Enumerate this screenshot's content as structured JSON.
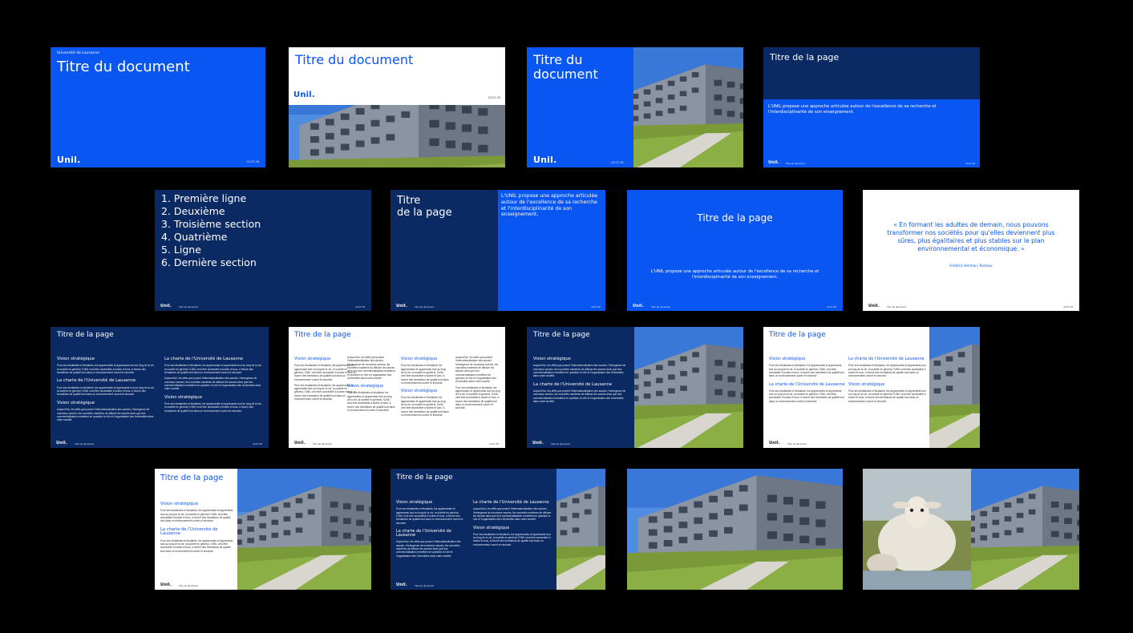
{
  "brand": {
    "logo": "Unil.",
    "university": "Université de Lausanne",
    "date": "23.07.25",
    "footer_title": "Titre du document"
  },
  "colors": {
    "blue": "#0a56f3",
    "navy": "#0b2a63",
    "white": "#ffffff",
    "background": "#000000"
  },
  "texts": {
    "doc_title": "Titre du document",
    "doc_title_line1": "Titre du",
    "doc_title_line2": "document",
    "page_title": "Titre de la page",
    "page_title_line1": "Titre",
    "page_title_line2": "de la page",
    "intro": "L'UNIL propose une approche articulée autour de l'excellence de sa recherche et l'interdisciplinarité de son enseignement.",
    "toc": [
      "1. Première ligne",
      "2. Deuxième",
      "3. Troisième section",
      "4. Quatrième",
      "5. Ligne",
      "6. Dernière section"
    ],
    "quote": "« En formant les adultes de demain, nous pouvons transformer nos sociétés pour qu'elles deviennent plus sûres, plus égalitaires et plus stables sur le plan environnemental et économique. »",
    "quote_author": "Frédéric Herman, Recteur",
    "heading_vision": "Vision stratégique",
    "heading_charte": "La charte de l'Université de Lausanne",
    "body_1": "Pour ses étudiantes et étudiants, les apprenantes et apprenants tout au long de la vie, la société en général, l'UNIL veut être accessible à toutes et tous, à fournir des formations de qualité tout dans un environnement ouvert et sécurisé.",
    "body_2": "Aujourd'hui, les défis que posent l'internationalisation des savoirs, l'émergence de nouveaux savoirs, les nouvelles manières de diffuser les savoirs ainsi que leur commercialisation remettent en question le rôle et l'organisation des Universités dans notre société."
  }
}
